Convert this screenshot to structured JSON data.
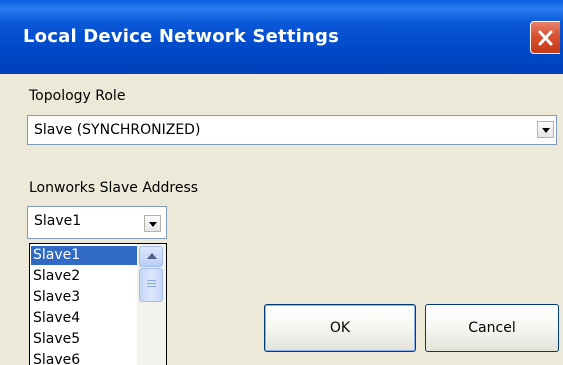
{
  "window": {
    "title": "Local Device Network Settings"
  },
  "topology": {
    "label": "Topology Role",
    "selected": "Slave (SYNCHRONIZED)"
  },
  "slave_address": {
    "label": "Lonworks Slave Address",
    "selected": "Slave1",
    "options": [
      "Slave1",
      "Slave2",
      "Slave3",
      "Slave4",
      "Slave5",
      "Slave6"
    ],
    "highlighted_index": 0
  },
  "buttons": {
    "ok": "OK",
    "cancel": "Cancel"
  },
  "colors": {
    "titlebar": "#0048c8",
    "close_button": "#d9512f",
    "selection": "#316ac5",
    "dialog_background": "#ece9d8"
  },
  "icons": {
    "close": "close-icon",
    "combo_arrow": "chevron-down-icon",
    "scroll_up": "chevron-up-icon"
  }
}
